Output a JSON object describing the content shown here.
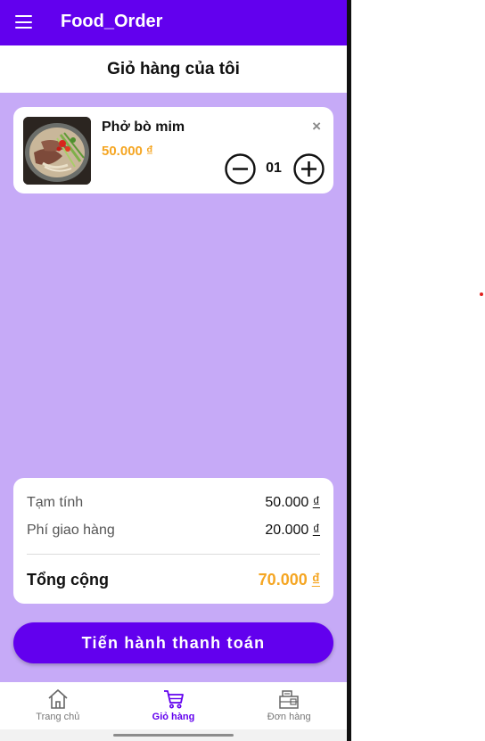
{
  "appbar": {
    "title": "Food_Order"
  },
  "page": {
    "title": "Giỏ hàng của tôi"
  },
  "cart": {
    "items": [
      {
        "name": "Phở bò mim",
        "price": "50.000 ₫",
        "quantity": "01",
        "remove": "×"
      }
    ]
  },
  "summary": {
    "subtotal_label": "Tạm tính",
    "subtotal_value": "50.000",
    "shipping_label": "Phí giao hàng",
    "shipping_value": "20.000",
    "total_label": "Tổng cộng",
    "total_value": "70.000",
    "currency": "₫"
  },
  "checkout": {
    "label": "Tiến hành thanh toán"
  },
  "bottom_nav": {
    "items": [
      {
        "label": "Trang chủ",
        "icon": "home-icon",
        "active": false
      },
      {
        "label": "Giỏ hàng",
        "icon": "cart-icon",
        "active": true
      },
      {
        "label": "Đơn hàng",
        "icon": "orders-icon",
        "active": false
      }
    ]
  },
  "colors": {
    "primary": "#6200ee",
    "background": "#c6aaf7",
    "price": "#f5a623"
  }
}
